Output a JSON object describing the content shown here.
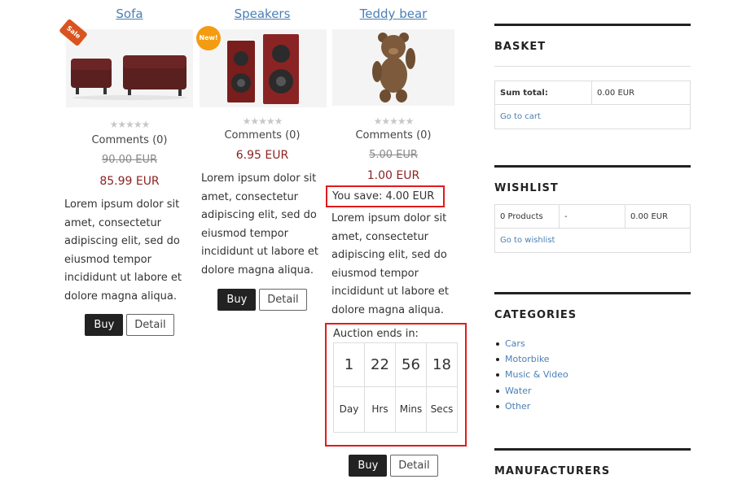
{
  "products": [
    {
      "title": "Sofa",
      "badge": "Sale",
      "icon": "sofa-image",
      "stars": "★★★★★",
      "comments": "Comments (0)",
      "old_price": "90.00 EUR",
      "price": "85.99 EUR",
      "description": "Lorem ipsum dolor sit amet, consectetur adipiscing elit, sed do eiusmod tempor incididunt ut labore et dolore magna aliqua.",
      "buy_label": "Buy",
      "detail_label": "Detail"
    },
    {
      "title": "Speakers",
      "badge": "New!",
      "icon": "speakers-image",
      "stars": "★★★★★",
      "comments": "Comments (0)",
      "price": "6.95 EUR",
      "description": "Lorem ipsum dolor sit amet, consectetur adipiscing elit, sed do eiusmod tempor incididunt ut labore et dolore magna aliqua.",
      "buy_label": "Buy",
      "detail_label": "Detail"
    },
    {
      "title": "Teddy bear",
      "icon": "teddy-bear-image",
      "stars": "★★★★★",
      "comments": "Comments (0)",
      "old_price": "5.00 EUR",
      "price": "1.00 EUR",
      "you_save": "You save: 4.00 EUR",
      "description": "Lorem ipsum dolor sit amet, consectetur adipiscing elit, sed do eiusmod tempor incididunt ut labore et dolore magna aliqua.",
      "auction": {
        "label": "Auction ends in:",
        "values": [
          "1",
          "22",
          "56",
          "18"
        ],
        "units": [
          "Day",
          "Hrs",
          "Mins",
          "Secs"
        ]
      },
      "buy_label": "Buy",
      "detail_label": "Detail"
    }
  ],
  "sidebar": {
    "basket": {
      "title": "BASKET",
      "sum_label": "Sum total:",
      "sum_value": "0.00 EUR",
      "link": "Go to cart"
    },
    "wishlist": {
      "title": "WISHLIST",
      "count": "0 Products",
      "separator": "-",
      "total": "0.00 EUR",
      "link": "Go to wishlist"
    },
    "categories": {
      "title": "CATEGORIES",
      "items": [
        "Cars",
        "Motorbike",
        "Music & Video",
        "Water",
        "Other"
      ]
    },
    "manufacturers": {
      "title": "MANUFACTURERS"
    }
  },
  "colors": {
    "price": "#8b2222",
    "link": "#4a7fb5",
    "highlight_border": "#e21b1b"
  }
}
